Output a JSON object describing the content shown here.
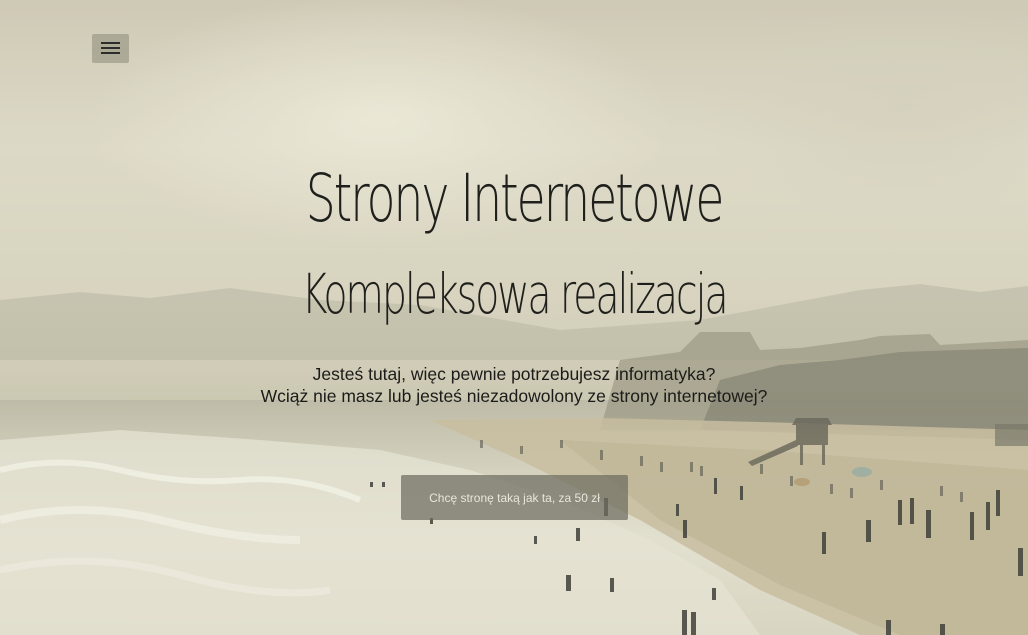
{
  "hero": {
    "title": "Strony Internetowe",
    "subtitle": "Kompleksowa realizacja",
    "lead_line_1": "Jesteś tutaj, więc pewnie potrzebujesz informatyka?",
    "lead_line_2": "Wciąż nie masz lub jesteś niezadowolony ze strony internetowej?",
    "cta_label": "Chcę stronę taką jak ta, za 50 zł"
  },
  "nav": {
    "menu_icon": "hamburger-menu-icon"
  },
  "colors": {
    "text": "#1f1f1c",
    "button_bg": "#6e6c60",
    "button_text": "#e8e6dc"
  }
}
